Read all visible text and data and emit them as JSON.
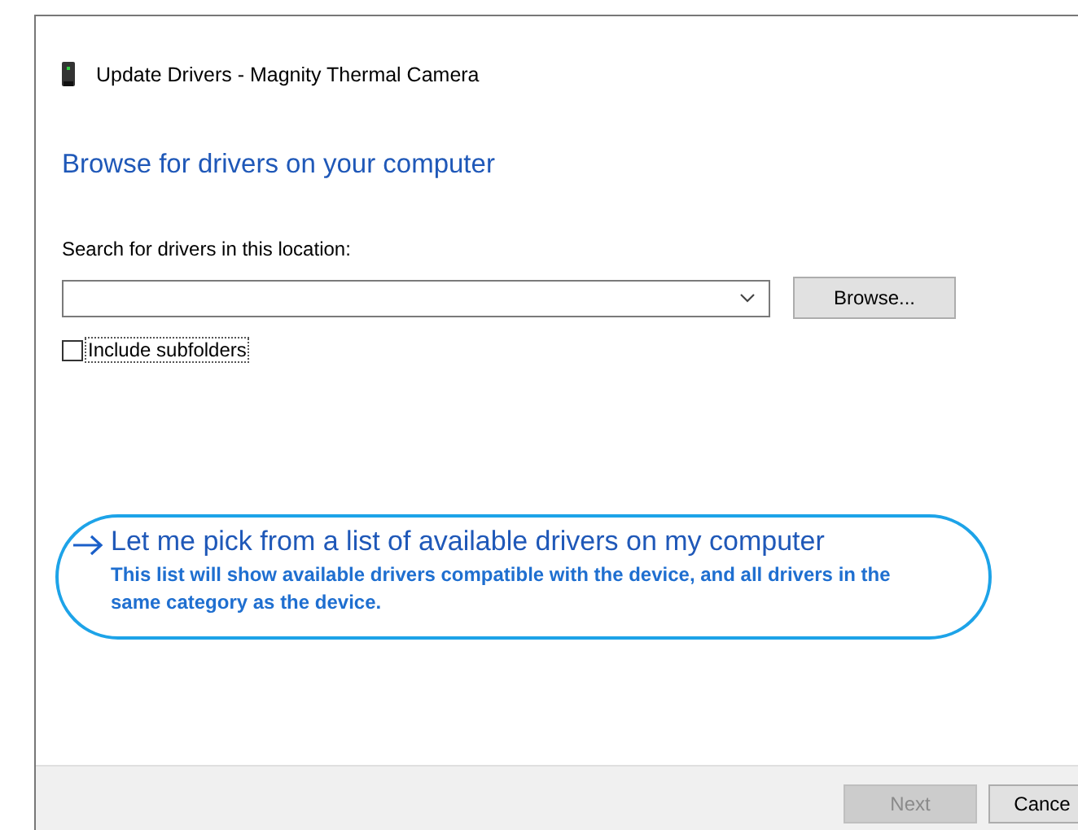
{
  "window": {
    "title": "Update Drivers - Magnity Thermal Camera"
  },
  "heading": "Browse for drivers on your computer",
  "location": {
    "label": "Search for drivers in this location:",
    "browse_button": "Browse..."
  },
  "include_subfolders": {
    "label": "Include subfolders",
    "checked": false
  },
  "pick_option": {
    "title": "Let me pick from a list of available drivers on my computer",
    "description": "This list will show available drivers compatible with the device, and all drivers in the same category as the device."
  },
  "buttons": [
    {
      "label": "Next",
      "disabled": true
    },
    {
      "label": "Cance",
      "disabled": false
    }
  ]
}
